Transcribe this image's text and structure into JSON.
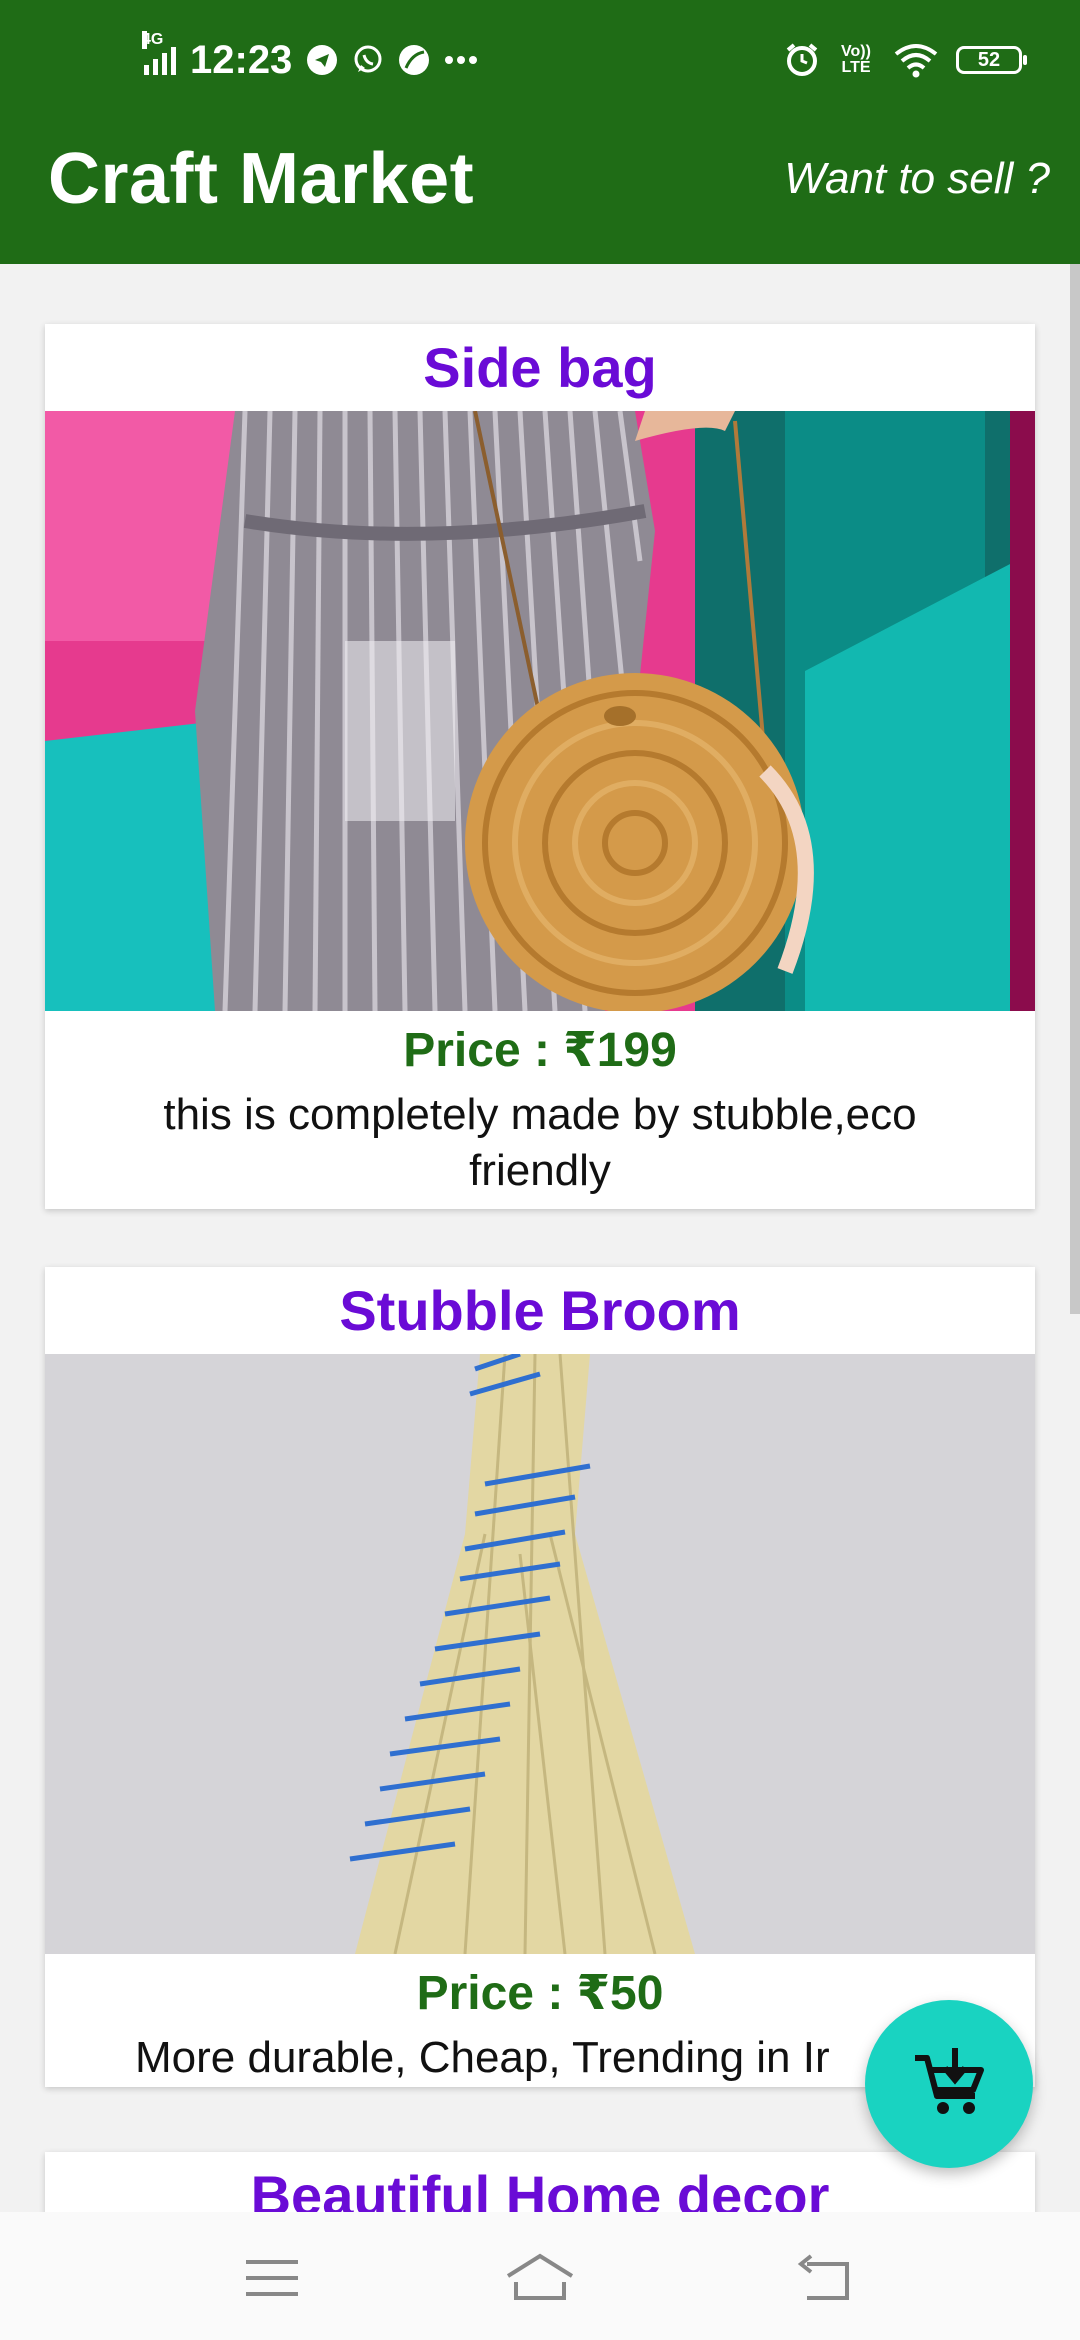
{
  "status_bar": {
    "network": "4G",
    "time": "12:23",
    "left_icons": [
      "telegram-icon",
      "whatsapp-icon",
      "leaf-icon",
      "more-dots-icon"
    ],
    "volte": "Vo)) LTE",
    "battery": "52"
  },
  "app_bar": {
    "title": "Craft Market",
    "sell_link": "Want to sell ?"
  },
  "products": [
    {
      "title": "Side bag",
      "price": "Price : ₹199",
      "description": "this is completely made by stubble,eco friendly"
    },
    {
      "title": "Stubble Broom",
      "price": "Price : ₹50",
      "description": "More durable, Cheap, Trending in Ir"
    },
    {
      "title": "Beautiful Home decor"
    }
  ],
  "fab": {
    "icon": "cart-download-icon"
  },
  "nav_bar": {
    "icons": [
      "menu-icon",
      "home-icon",
      "back-icon"
    ]
  },
  "colors": {
    "app_bar": "#1f6c16",
    "title_purple": "#6a0bd6",
    "price_green": "#1f6c16",
    "fab": "#19d3c1"
  }
}
